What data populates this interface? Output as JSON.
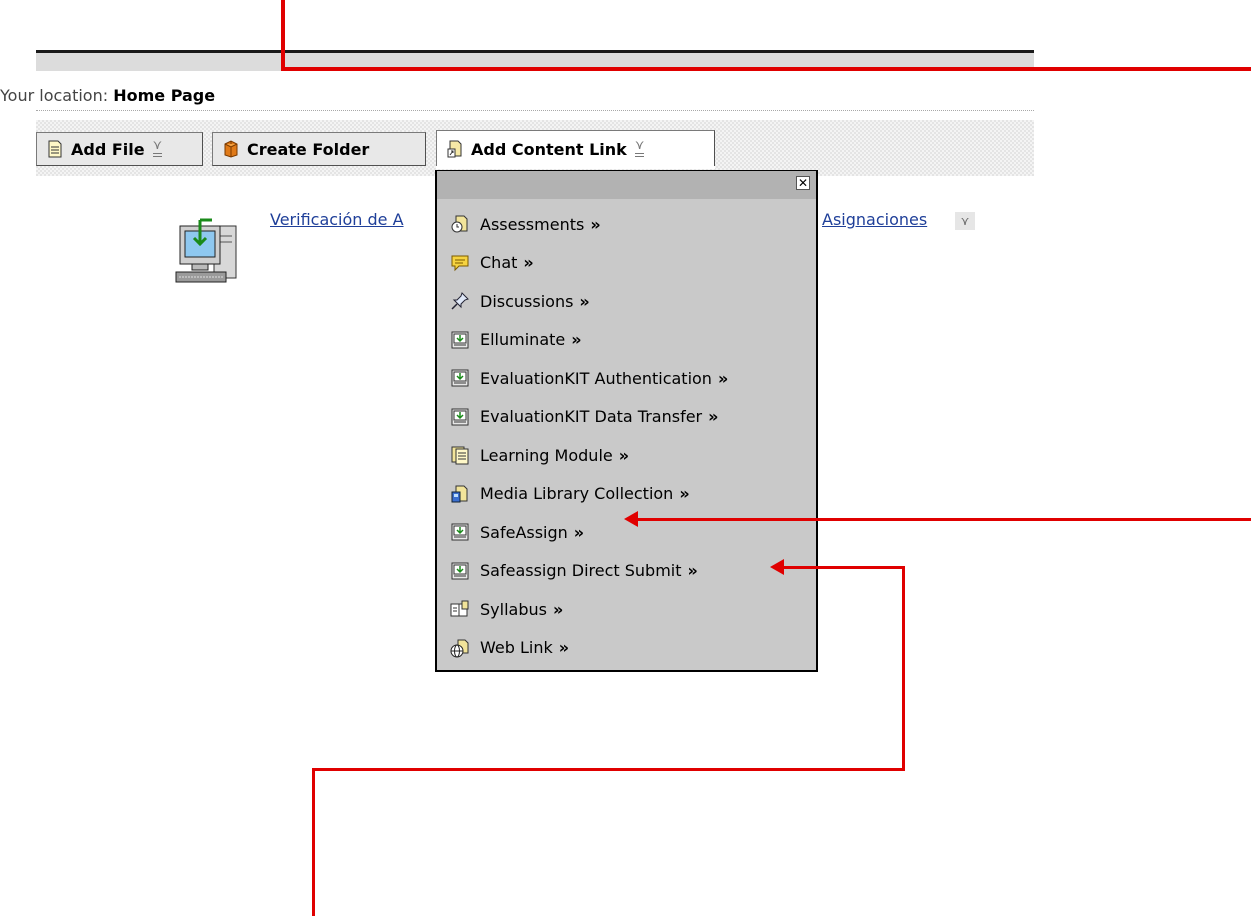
{
  "location": {
    "prefix": "Your location:",
    "current": "Home Page"
  },
  "toolbar": {
    "add_file": "Add File",
    "create_folder": "Create Folder",
    "add_content_link": "Add Content Link"
  },
  "content_item": {
    "title_start": "Verificación de A",
    "title_end": "Asignaciones"
  },
  "menu": {
    "close": "✕",
    "more": "»",
    "items": [
      {
        "label": "Assessments",
        "icon": "assessment-icon"
      },
      {
        "label": "Chat",
        "icon": "chat-icon"
      },
      {
        "label": "Discussions",
        "icon": "pushpin-icon"
      },
      {
        "label": "Elluminate",
        "icon": "tool-icon"
      },
      {
        "label": "EvaluationKIT Authentication",
        "icon": "tool-icon"
      },
      {
        "label": "EvaluationKIT Data Transfer",
        "icon": "tool-icon"
      },
      {
        "label": "Learning Module",
        "icon": "module-icon"
      },
      {
        "label": "Media Library Collection",
        "icon": "media-library-icon"
      },
      {
        "label": "SafeAssign",
        "icon": "tool-icon"
      },
      {
        "label": "Safeassign Direct Submit",
        "icon": "tool-icon"
      },
      {
        "label": "Syllabus",
        "icon": "syllabus-icon"
      },
      {
        "label": "Web Link",
        "icon": "globe-icon"
      }
    ]
  },
  "annotation_color": "#e00000"
}
